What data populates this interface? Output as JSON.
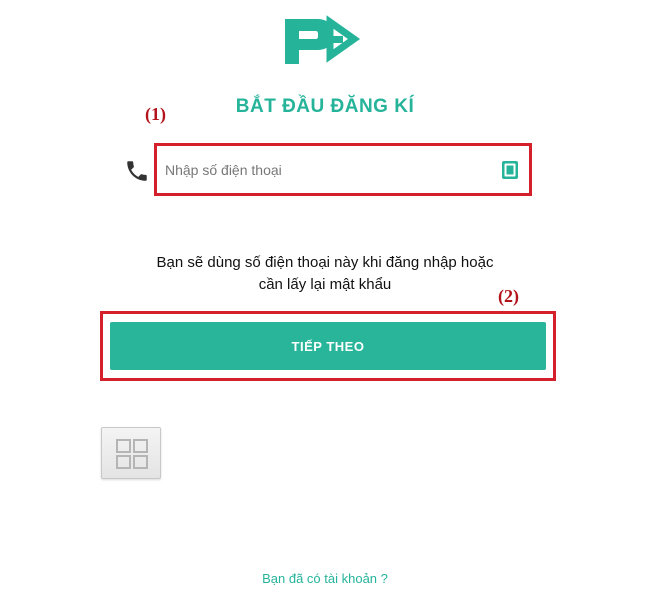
{
  "app": {
    "logo_icon": "pv-arrow-logo-icon",
    "accent_color": "#25b49a"
  },
  "title": "BẮT ĐẦU ĐĂNG KÍ",
  "annotations": {
    "label_1": "(1)",
    "label_2": "(2)",
    "highlight_color": "#d3202a"
  },
  "phone": {
    "icon": "phone-icon",
    "placeholder": "Nhập số điện thoại",
    "value": "",
    "contact_icon": "contact-book-icon"
  },
  "hint": {
    "line1": "Bạn sẽ dùng số điện thoại này khi đăng nhập hoặc",
    "line2": "cần lấy lại mật khẩu"
  },
  "next_button": {
    "label": "TIẾP THEO",
    "color": "#28b59a"
  },
  "grid_button": {
    "icon": "grid-icon"
  },
  "login_link": {
    "label": "Bạn đã có tài khoản ?"
  }
}
